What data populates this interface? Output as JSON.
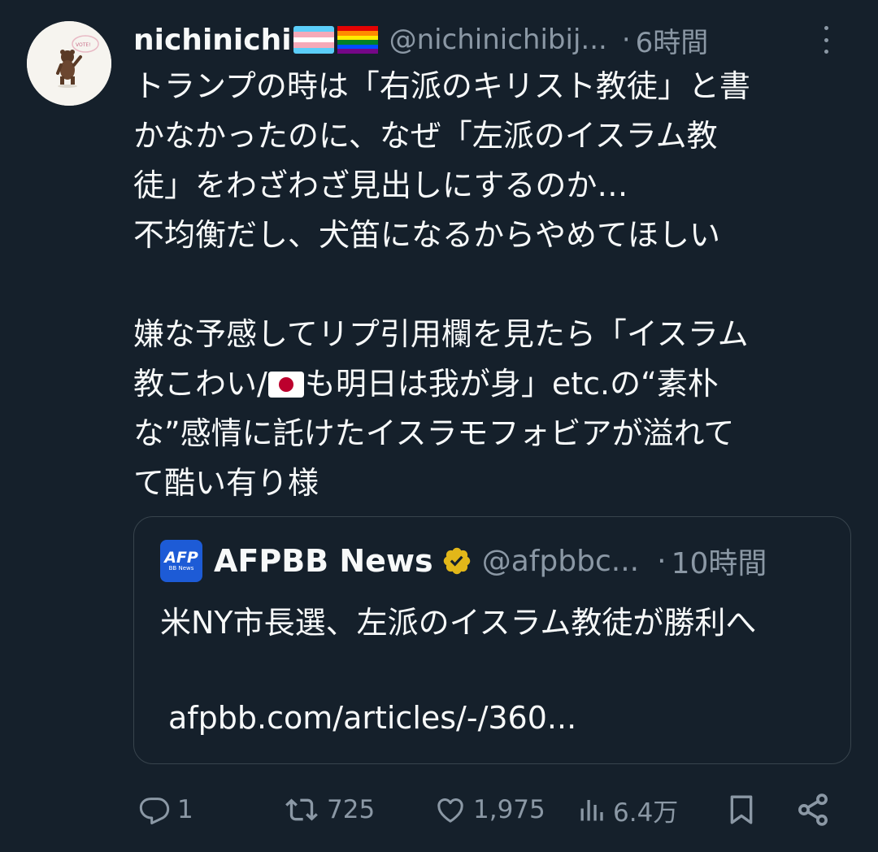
{
  "author": {
    "display_name": "nichinichi",
    "handle": "@nichinichibij...",
    "separator": "·",
    "time": "6時間",
    "avatar_badge_text": "VOTE!"
  },
  "body": {
    "lines": [
      "トランプの時は「右派のキリスト教徒」と書",
      "かなかったのに、なぜ「左派のイスラム教",
      "徒」をわざわざ見出しにするのか…",
      "不均衡だし、犬笛になるからやめてほしい",
      "",
      "嫌な予感してリプ引用欄を見たら「イスラム",
      "教こわい/",
      "も明日は我が身」etc.の“素朴",
      "な”感情に託けたイスラモフォビアが溢れて",
      "て酷い有り様"
    ]
  },
  "quote": {
    "logo_text": "AFP",
    "logo_subtext": "BB News",
    "display_name": "AFPBB News",
    "handle": "@afpbbc...",
    "separator": "·",
    "time": "10時間",
    "text": "米NY市長選、左派のイスラム教徒が勝利へ",
    "link": "afpbb.com/articles/-/360..."
  },
  "actions": {
    "reply_count": "1",
    "retweet_count": "725",
    "like_count": "1,975",
    "views_count": "6.4万"
  },
  "icons": {
    "more": "more-vertical-icon",
    "verified": "verified-gold-badge-icon",
    "reply": "reply-icon",
    "retweet": "retweet-icon",
    "like": "heart-icon",
    "views": "analytics-icon",
    "bookmark": "bookmark-icon",
    "share": "share-icon"
  },
  "colors": {
    "background": "#15202b",
    "text": "#f7f9f9",
    "secondary": "#8b98a5",
    "border": "#38444d",
    "verified_gold": "#e2b719",
    "afp_blue": "#1d5bd6"
  }
}
